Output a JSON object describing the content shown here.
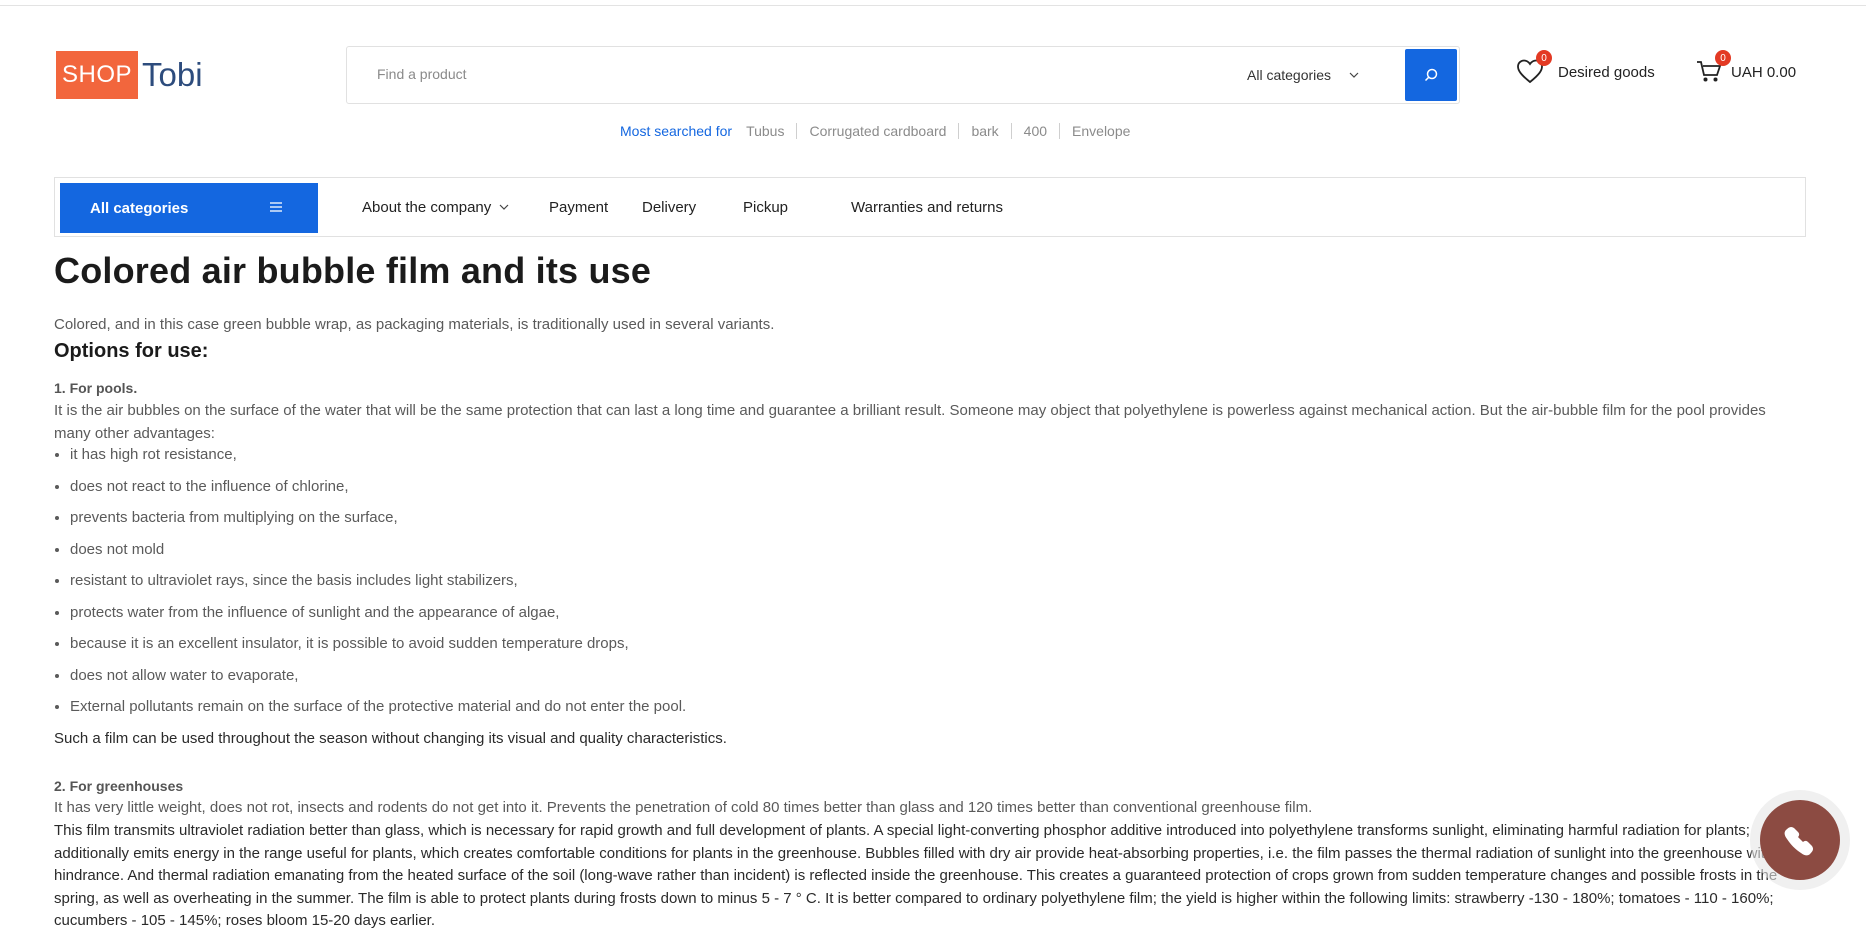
{
  "header": {
    "logo_shop": "SHOP",
    "logo_tobi": "Tobi",
    "search_placeholder": "Find a product",
    "search_category": "All categories",
    "wishlist_count": "0",
    "wishlist_label": "Desired goods",
    "cart_count": "0",
    "cart_total": "UAH 0.00"
  },
  "popular": {
    "label": "Most searched for",
    "items": [
      "Tubus",
      "Corrugated cardboard",
      "bark",
      "400",
      "Envelope"
    ]
  },
  "nav": {
    "all_categories": "All categories",
    "items": [
      "About the company",
      "Payment",
      "Delivery",
      "Pickup",
      "Warranties and returns"
    ]
  },
  "article": {
    "title": "Colored air bubble film and its use",
    "intro": "Colored, and in this case green bubble wrap, as packaging materials, is traditionally used in several variants.",
    "options_heading": "Options for use:",
    "section1_title": "1. For pools.",
    "section1_text": "It is the air bubbles on the surface of the water that will be the same protection that can last a long time and guarantee a brilliant result. Someone may object that polyethylene is powerless against mechanical action. But the air-bubble film for the pool provides many other advantages:",
    "advantages": [
      "it has high rot resistance,",
      "does not react to the influence of chlorine,",
      "prevents bacteria from multiplying on the surface,",
      "does not mold",
      "resistant to ultraviolet rays, since the basis includes light stabilizers,",
      "protects water from the influence of sunlight and the appearance of algae,",
      "because it is an excellent insulator, it is possible to avoid sudden temperature drops,",
      "does not allow water to evaporate,",
      "External pollutants remain on the surface of the protective material and do not enter the pool."
    ],
    "section1_conclusion": "Such a film can be used throughout the season without changing its visual and quality characteristics.",
    "section2_title": "2. For greenhouses",
    "section2_text1": "It has very little weight, does not rot, insects and rodents do not get into it. Prevents the penetration of cold 80 times better than glass and 120 times better than conventional greenhouse film.",
    "section2_text2": "This film transmits ultraviolet radiation better than glass, which is necessary for rapid growth and full development of plants. A special light-converting phosphor additive introduced into polyethylene transforms sunlight, eliminating harmful radiation for plants; additionally emits energy in the range useful for plants, which creates comfortable conditions for plants in the greenhouse. Bubbles filled with dry air provide heat-absorbing properties, i.e. the film passes the thermal radiation of sunlight into the greenhouse without hindrance. And thermal radiation emanating from the heated surface of the soil (long-wave rather than incident) is reflected inside the greenhouse. This creates a guaranteed protection of crops grown from sudden temperature changes and possible frosts in the spring, as well as overheating in the summer. The film is able to protect plants during frosts down to minus 5 - 7 ° C. It is better compared to ordinary polyethylene film; the yield is higher within the following limits: strawberry -130 - 180%; tomatoes - 110 - 160%; cucumbers - 105 - 145%; roses bloom 15-20 days earlier."
  },
  "colors": {
    "brand_orange": "#f2663d",
    "brand_navy": "#2d4c7d",
    "accent_blue": "#1467e0",
    "badge_red": "#e33a24",
    "phone_button": "#8c4b42"
  },
  "icons": [
    "search-icon",
    "chevron-down-icon",
    "heart-icon",
    "cart-icon",
    "menu-icon",
    "phone-icon"
  ]
}
